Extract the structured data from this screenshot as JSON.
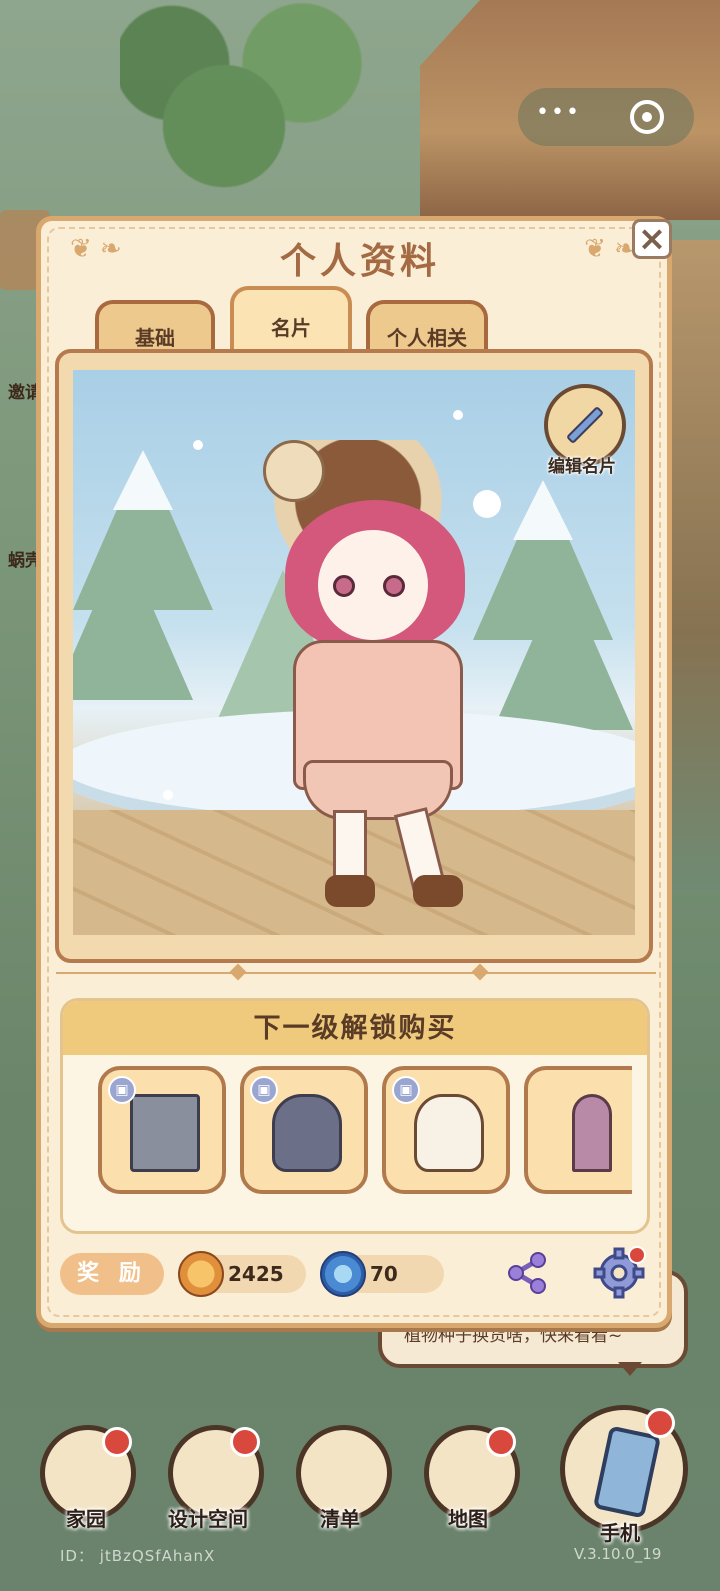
{
  "dialog": {
    "title": "个人资料",
    "close_icon": "close-icon",
    "tabs": [
      {
        "label": "基础",
        "active": false
      },
      {
        "label": "名片",
        "active": true
      },
      {
        "label": "个人相关",
        "active": false
      }
    ],
    "edit_card_label": "编辑名片",
    "unlock": {
      "header": "下一级解锁购买",
      "items": [
        {
          "name": "fryer",
          "icon": "fryer-icon"
        },
        {
          "name": "armchair",
          "icon": "armchair-icon"
        },
        {
          "name": "stand-mixer",
          "icon": "stand-mixer-icon"
        },
        {
          "name": "arched-shelf",
          "icon": "arched-shelf-icon"
        }
      ]
    },
    "reward_label": "奖 励",
    "currencies": [
      {
        "icon": "seed-coin-icon",
        "value": "2425"
      },
      {
        "icon": "spiral-gem-icon",
        "value": "70"
      }
    ]
  },
  "background": {
    "side_labels": [
      "邀请",
      "蜗壳"
    ],
    "bubble_text": "植物种子换货啥，快来看看~"
  },
  "nav": {
    "items": [
      {
        "label": "家园",
        "has_dot": true
      },
      {
        "label": "设计空间",
        "has_dot": true
      },
      {
        "label": "清单",
        "has_dot": false
      },
      {
        "label": "地图",
        "has_dot": true
      },
      {
        "label": "手机",
        "has_dot": true
      }
    ]
  },
  "footer": {
    "id": "ID： jtBzQSfAhanX",
    "version": "V.3.10.0_19"
  },
  "colors": {
    "dialog_bg": "#fbeed6",
    "accent_brown": "#a36a43",
    "notification_red": "#d8483c"
  }
}
